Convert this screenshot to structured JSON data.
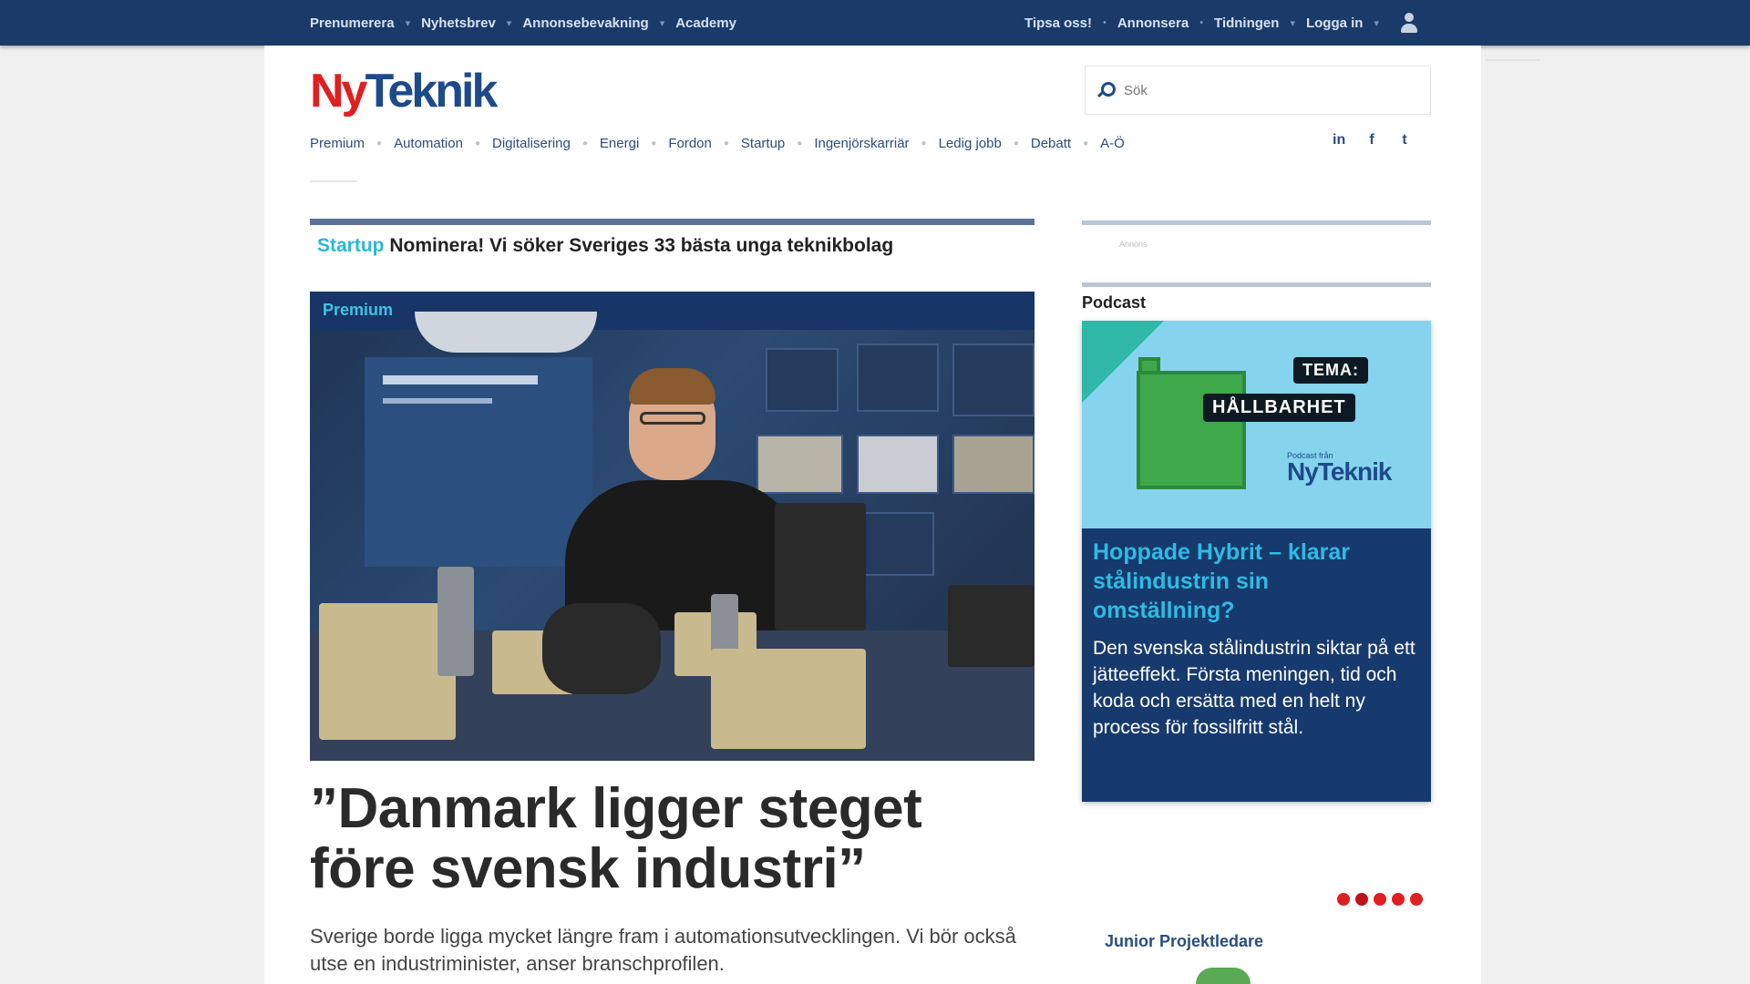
{
  "topbar": {
    "left": [
      "Prenumerera",
      "Nyhetsbrev",
      "Annonsebevakning",
      "Academy"
    ],
    "right": [
      "Tipsa oss!",
      "Annonsera",
      "Tidningen",
      "Logga in"
    ]
  },
  "logo": {
    "part1": "Ny",
    "part2": "Teknik"
  },
  "search": {
    "placeholder": "Sök"
  },
  "nav": {
    "items": [
      "Premium",
      "Automation",
      "Digitalisering",
      "Energi",
      "Fordon",
      "Startup",
      "Ingenjörskarriär",
      "Ledig jobb",
      "Debatt",
      "A-Ö"
    ]
  },
  "social": [
    "in",
    "f",
    "t"
  ],
  "kicker": {
    "tag": "Startup",
    "text": "Nominera! Vi söker Sveriges 33 bästa unga teknikbolag"
  },
  "hero": {
    "badge": "Premium",
    "headline": "”Danmark ligger steget före svensk industri”",
    "ingress": "Sverige borde ligga mycket längre fram i automationsutvecklingen. Vi bör också utse en industriminister, anser branschprofilen."
  },
  "sidebar": {
    "tiny_label": "Annons",
    "podcast_label": "Podcast",
    "podcast_tags": [
      "TEMA:",
      "HÅLLBARHET"
    ],
    "podcast_brand_small": "Podcast från",
    "podcast_brand": "NyTeknik",
    "podcast_title": "Hoppade Hybrit – klarar stålindustrin sin omställning?",
    "podcast_desc": "Den svenska stålindustrin siktar på ett jätteeffekt. Första meningen, tid och koda och ersätta med en helt ny process för fossilfritt stål.",
    "job_label": "Junior Projektledare"
  },
  "colors": {
    "topbar": "#1a3a6a",
    "brand_red": "#e02020",
    "brand_blue": "#1d4a8a",
    "accent_cyan": "#2ab7d6",
    "podcast_bg": "#173a6e"
  }
}
